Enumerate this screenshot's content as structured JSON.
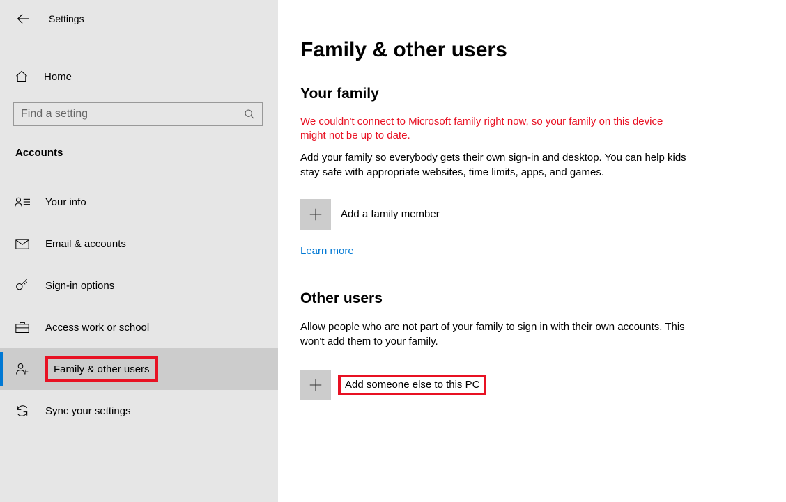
{
  "app": {
    "title": "Settings"
  },
  "nav": {
    "home": "Home",
    "search_placeholder": "Find a setting",
    "section": "Accounts",
    "items": [
      {
        "label": "Your info"
      },
      {
        "label": "Email & accounts"
      },
      {
        "label": "Sign-in options"
      },
      {
        "label": "Access work or school"
      },
      {
        "label": "Family & other users"
      },
      {
        "label": "Sync your settings"
      }
    ]
  },
  "main": {
    "title": "Family & other users",
    "family": {
      "heading": "Your family",
      "error": "We couldn't connect to Microsoft family right now, so your family on this device might not be up to date.",
      "desc": "Add your family so everybody gets their own sign-in and desktop. You can help kids stay safe with appropriate websites, time limits, apps, and games.",
      "add_label": "Add a family member",
      "learn_more": "Learn more"
    },
    "other": {
      "heading": "Other users",
      "desc": "Allow people who are not part of your family to sign in with their own accounts. This won't add them to your family.",
      "add_label": "Add someone else to this PC"
    }
  }
}
